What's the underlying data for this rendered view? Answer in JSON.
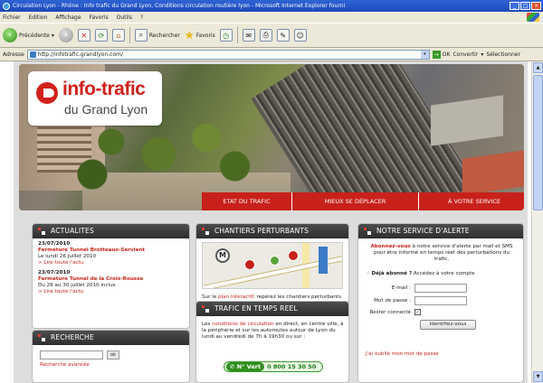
{
  "window": {
    "title": "Circulation Lyon - Rhône : Info trafic du Grand Lyon, Conditions circulation routière lyon - Microsoft Internet Explorer fourni",
    "min": "_",
    "max": "□",
    "close": "×"
  },
  "menu": [
    "Fichier",
    "Edition",
    "Affichage",
    "Favoris",
    "Outils",
    "?"
  ],
  "toolbar": {
    "back": "Précédente",
    "search": "Rechercher",
    "favorites": "Favoris"
  },
  "address": {
    "label": "Adresse",
    "url": "http://infotrafic.grandlyon.com/",
    "go": "OK",
    "links1": "Convertir",
    "links2": "Sélectionner"
  },
  "logo": {
    "line1": "info-trafic",
    "line2": "du Grand Lyon"
  },
  "nav": [
    "ETAT DU TRAFIC",
    "MIEUX SE DÉPLACER",
    "À VOTRE SERVICE"
  ],
  "actualites": {
    "title": "ACTUALITES",
    "items": [
      {
        "date": "23/07/2010",
        "headline": "Fermeture Tunnel Brotteaux-Servient",
        "desc": "Le lundi 26 juillet 2010",
        "more": "> Lire toute l'actu"
      },
      {
        "date": "23/07/2010",
        "headline": "Fermeture Tunnel de la Croix-Rousse",
        "desc": "Du 26 au 30 juillet 2010 inclus",
        "more": "> Lire toute l'actu"
      }
    ]
  },
  "recherche": {
    "title": "RECHERCHE",
    "ok": "ok",
    "advanced": "Recherche avancée"
  },
  "chantiers": {
    "title": "CHANTIERS PERTURBANTS",
    "text_before": "Sur le ",
    "link": "plan interactif",
    "text_after": ", repérez les chantiers perturbants sur votre parcours."
  },
  "trafic": {
    "title": "TRAFIC EN TEMPS REEL",
    "text_before": "Les ",
    "link": "conditions de circulation",
    "text_after": " en direct, en centre ville, à la périphérie et sur les autoroutes autour de Lyon du lundi au vendredi de 7h à 19h30 ou sur :",
    "vert_label": "N° Vert",
    "vert_number": "0 800 15 30 50"
  },
  "alerte": {
    "title": "NOTRE SERVICE D'ALERTE",
    "intro_red": "Abonnez-vous",
    "intro_rest": " à notre service d'alerte par mail et SMS pour être informé en temps réel des perturbations du trafic.",
    "already": "Déjà abonné ?",
    "already_rest": " Accédez à votre compte",
    "email_label": "E-mail :",
    "password_label": "Mot de passe :",
    "remember_label": "Rester connecté",
    "remember_check": "✓",
    "submit": "Identifiez-vous",
    "forgot": "J'ai oublié mon mot de passe"
  }
}
